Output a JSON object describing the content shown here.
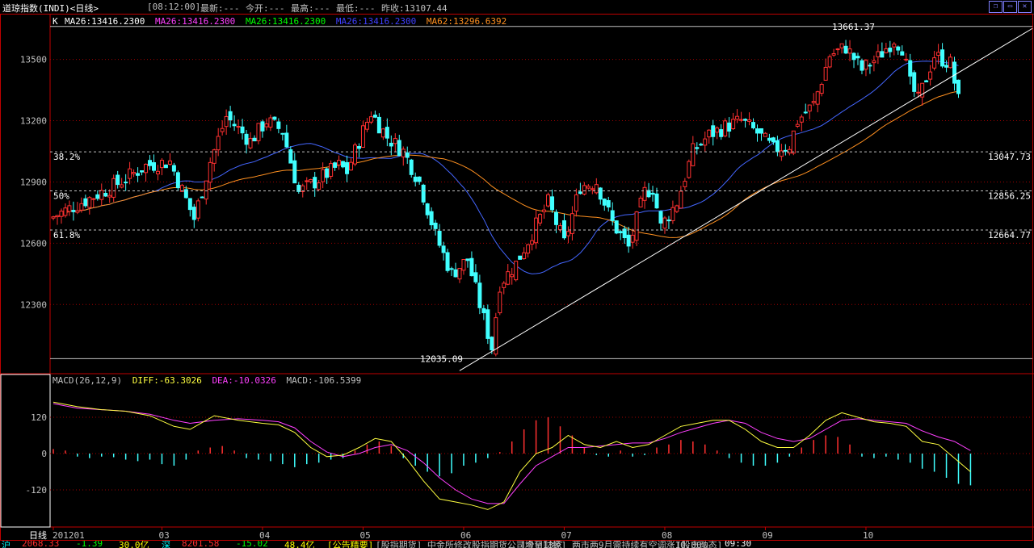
{
  "window": {
    "title": "道琼指数(INDI)<日线>",
    "time": "[08:12:00]",
    "quote_latest": "最新:---",
    "quote_open": "今开:---",
    "quote_high": "最高:---",
    "quote_low": "最低:---",
    "quote_prev_close": "昨收:13107.44"
  },
  "ma_legend": {
    "k_label": "K",
    "items": [
      {
        "text": "MA26:13416.2300",
        "color": "#ffffff"
      },
      {
        "text": "MA26:13416.2300",
        "color": "#ff40ff"
      },
      {
        "text": "MA26:13416.2300",
        "color": "#00ff00"
      },
      {
        "text": "MA26:13416.2300",
        "color": "#4040ff"
      },
      {
        "text": "MA62:13296.6392",
        "color": "#ff9020"
      }
    ]
  },
  "macd_legend": {
    "name": "MACD(26,12,9)",
    "diff": "DIFF:-63.3026",
    "dea": "DEA:-10.0326",
    "macd": "MACD:-106.5399"
  },
  "status": {
    "period_label": "日线",
    "items": [
      {
        "text": "沪",
        "color": "#00ffff"
      },
      {
        "text": "2068.33",
        "color": "#ff3030"
      },
      {
        "text": "-1.39",
        "color": "#00ff00"
      },
      {
        "text": "30.0亿",
        "color": "#ffff00"
      },
      {
        "text": "深",
        "color": "#00ffff"
      },
      {
        "text": "8201.58",
        "color": "#ff3030"
      },
      {
        "text": "-15.02",
        "color": "#00ff00"
      },
      {
        "text": "48.4亿",
        "color": "#ffff00"
      },
      {
        "text": "[公告精要]",
        "color": "#ffff00"
      },
      {
        "text": "[股指期货] 中金所修改股指期货公司增至13家",
        "color": "#c0c0c0"
      },
      {
        "text": "[今日财经] 两市两9月需持续有空调涨10.00%",
        "color": "#c0c0c0"
      },
      {
        "text": "[股市动态]",
        "color": "#c0c0c0"
      },
      {
        "text": "09:30",
        "color": "#ffffff"
      }
    ]
  },
  "chart_data": [
    {
      "type": "candlestick",
      "title": "道琼指数(INDI)<日线>",
      "y_ticks": [
        12300,
        12600,
        12900,
        13200,
        13500
      ],
      "ylim": [
        11985,
        13700
      ],
      "x_tick_labels": [
        "201201",
        "03",
        "04",
        "05",
        "06",
        "07",
        "08",
        "09",
        "10"
      ],
      "x_tick_index": [
        0,
        27,
        52,
        77,
        102,
        127,
        152,
        177,
        202
      ],
      "high_label": "13661.37",
      "low_label": "12035.09",
      "high_value": 13661.37,
      "low_value": 12035.09,
      "fib_levels": [
        {
          "label": "38.2%",
          "value": 13047.73,
          "value_label": "13047.73"
        },
        {
          "label": "50%",
          "value": 12856.25,
          "value_label": "12856.25"
        },
        {
          "label": "61.8%",
          "value": 12664.77,
          "value_label": "12664.77"
        }
      ],
      "trendline": {
        "x1_index": 106,
        "y1_value": 12035,
        "x2_index": 240,
        "y2_value": 13620
      },
      "ma_series": [
        {
          "name": "MA26",
          "color": "#4466ff"
        },
        {
          "name": "MA62",
          "color": "#ff9020"
        }
      ]
    },
    {
      "type": "bar",
      "title": "MACD(26,12,9)",
      "y_ticks": [
        120,
        0,
        -120
      ],
      "ylim": [
        -200,
        200
      ],
      "series": [
        {
          "name": "DIFF",
          "color": "#ffff40"
        },
        {
          "name": "DEA",
          "color": "#ff40ff"
        },
        {
          "name": "MACD",
          "color": "#ff3030"
        }
      ],
      "points": [
        {
          "x": 0,
          "diff": 170,
          "dea": 165
        },
        {
          "x": 6,
          "diff": 155,
          "dea": 150
        },
        {
          "x": 12,
          "diff": 145,
          "dea": 145
        },
        {
          "x": 18,
          "diff": 140,
          "dea": 140
        },
        {
          "x": 24,
          "diff": 125,
          "dea": 130
        },
        {
          "x": 30,
          "diff": 90,
          "dea": 110
        },
        {
          "x": 34,
          "diff": 80,
          "dea": 100
        },
        {
          "x": 40,
          "diff": 125,
          "dea": 110
        },
        {
          "x": 46,
          "diff": 110,
          "dea": 115
        },
        {
          "x": 52,
          "diff": 100,
          "dea": 110
        },
        {
          "x": 56,
          "diff": 95,
          "dea": 105
        },
        {
          "x": 60,
          "diff": 70,
          "dea": 85
        },
        {
          "x": 64,
          "diff": 20,
          "dea": 40
        },
        {
          "x": 68,
          "diff": -10,
          "dea": 5
        },
        {
          "x": 72,
          "diff": -5,
          "dea": -10
        },
        {
          "x": 76,
          "diff": 20,
          "dea": 0
        },
        {
          "x": 80,
          "diff": 50,
          "dea": 20
        },
        {
          "x": 84,
          "diff": 40,
          "dea": 30
        },
        {
          "x": 88,
          "diff": -20,
          "dea": 10
        },
        {
          "x": 92,
          "diff": -90,
          "dea": -30
        },
        {
          "x": 96,
          "diff": -150,
          "dea": -80
        },
        {
          "x": 100,
          "diff": -160,
          "dea": -120
        },
        {
          "x": 104,
          "diff": -170,
          "dea": -150
        },
        {
          "x": 108,
          "diff": -185,
          "dea": -165
        },
        {
          "x": 112,
          "diff": -160,
          "dea": -165
        },
        {
          "x": 116,
          "diff": -60,
          "dea": -100
        },
        {
          "x": 120,
          "diff": 0,
          "dea": -40
        },
        {
          "x": 124,
          "diff": 20,
          "dea": -10
        },
        {
          "x": 128,
          "diff": 60,
          "dea": 20
        },
        {
          "x": 132,
          "diff": 30,
          "dea": 20
        },
        {
          "x": 136,
          "diff": 20,
          "dea": 25
        },
        {
          "x": 140,
          "diff": 40,
          "dea": 30
        },
        {
          "x": 144,
          "diff": 20,
          "dea": 35
        },
        {
          "x": 148,
          "diff": 30,
          "dea": 35
        },
        {
          "x": 152,
          "diff": 60,
          "dea": 50
        },
        {
          "x": 156,
          "diff": 90,
          "dea": 70
        },
        {
          "x": 160,
          "diff": 100,
          "dea": 85
        },
        {
          "x": 164,
          "diff": 110,
          "dea": 100
        },
        {
          "x": 168,
          "diff": 110,
          "dea": 110
        },
        {
          "x": 172,
          "diff": 80,
          "dea": 100
        },
        {
          "x": 176,
          "diff": 40,
          "dea": 70
        },
        {
          "x": 180,
          "diff": 20,
          "dea": 50
        },
        {
          "x": 184,
          "diff": 20,
          "dea": 40
        },
        {
          "x": 188,
          "diff": 60,
          "dea": 50
        },
        {
          "x": 192,
          "diff": 110,
          "dea": 80
        },
        {
          "x": 196,
          "diff": 135,
          "dea": 110
        },
        {
          "x": 200,
          "diff": 120,
          "dea": 115
        },
        {
          "x": 204,
          "diff": 105,
          "dea": 110
        },
        {
          "x": 208,
          "diff": 100,
          "dea": 105
        },
        {
          "x": 212,
          "diff": 90,
          "dea": 100
        },
        {
          "x": 216,
          "diff": 40,
          "dea": 75
        },
        {
          "x": 220,
          "diff": 30,
          "dea": 55
        },
        {
          "x": 224,
          "diff": -15,
          "dea": 40
        },
        {
          "x": 228,
          "diff": -60,
          "dea": 10
        }
      ],
      "histogram": [
        {
          "x": 0,
          "v": 15
        },
        {
          "x": 3,
          "v": 10
        },
        {
          "x": 6,
          "v": -10
        },
        {
          "x": 9,
          "v": -15
        },
        {
          "x": 12,
          "v": -10
        },
        {
          "x": 15,
          "v": -12
        },
        {
          "x": 18,
          "v": -20
        },
        {
          "x": 21,
          "v": -25
        },
        {
          "x": 24,
          "v": -20
        },
        {
          "x": 27,
          "v": -35
        },
        {
          "x": 30,
          "v": -40
        },
        {
          "x": 33,
          "v": -20
        },
        {
          "x": 36,
          "v": 10
        },
        {
          "x": 39,
          "v": 20
        },
        {
          "x": 42,
          "v": 25
        },
        {
          "x": 45,
          "v": 10
        },
        {
          "x": 48,
          "v": -15
        },
        {
          "x": 51,
          "v": -20
        },
        {
          "x": 54,
          "v": -25
        },
        {
          "x": 57,
          "v": -35
        },
        {
          "x": 60,
          "v": -45
        },
        {
          "x": 63,
          "v": -35
        },
        {
          "x": 66,
          "v": -30
        },
        {
          "x": 69,
          "v": -20
        },
        {
          "x": 72,
          "v": -15
        },
        {
          "x": 75,
          "v": 10
        },
        {
          "x": 78,
          "v": 30
        },
        {
          "x": 81,
          "v": 40
        },
        {
          "x": 84,
          "v": 25
        },
        {
          "x": 87,
          "v": -15
        },
        {
          "x": 90,
          "v": -40
        },
        {
          "x": 93,
          "v": -60
        },
        {
          "x": 96,
          "v": -75
        },
        {
          "x": 99,
          "v": -65
        },
        {
          "x": 102,
          "v": -40
        },
        {
          "x": 105,
          "v": -30
        },
        {
          "x": 108,
          "v": -15
        },
        {
          "x": 111,
          "v": 5
        },
        {
          "x": 114,
          "v": 40
        },
        {
          "x": 117,
          "v": 80
        },
        {
          "x": 120,
          "v": 110
        },
        {
          "x": 123,
          "v": 120
        },
        {
          "x": 126,
          "v": 90
        },
        {
          "x": 129,
          "v": 60
        },
        {
          "x": 132,
          "v": 20
        },
        {
          "x": 135,
          "v": -5
        },
        {
          "x": 138,
          "v": -10
        },
        {
          "x": 141,
          "v": 10
        },
        {
          "x": 144,
          "v": -10
        },
        {
          "x": 147,
          "v": -5
        },
        {
          "x": 150,
          "v": 20
        },
        {
          "x": 153,
          "v": 30
        },
        {
          "x": 156,
          "v": 45
        },
        {
          "x": 159,
          "v": 40
        },
        {
          "x": 162,
          "v": 30
        },
        {
          "x": 165,
          "v": 10
        },
        {
          "x": 168,
          "v": -15
        },
        {
          "x": 171,
          "v": -30
        },
        {
          "x": 174,
          "v": -40
        },
        {
          "x": 177,
          "v": -40
        },
        {
          "x": 180,
          "v": -30
        },
        {
          "x": 183,
          "v": -10
        },
        {
          "x": 186,
          "v": 20
        },
        {
          "x": 189,
          "v": 45
        },
        {
          "x": 192,
          "v": 60
        },
        {
          "x": 195,
          "v": 55
        },
        {
          "x": 198,
          "v": 30
        },
        {
          "x": 201,
          "v": -10
        },
        {
          "x": 204,
          "v": -15
        },
        {
          "x": 207,
          "v": -10
        },
        {
          "x": 210,
          "v": -20
        },
        {
          "x": 213,
          "v": -30
        },
        {
          "x": 216,
          "v": -50
        },
        {
          "x": 219,
          "v": -60
        },
        {
          "x": 222,
          "v": -80
        },
        {
          "x": 225,
          "v": -100
        },
        {
          "x": 228,
          "v": -105
        }
      ]
    }
  ]
}
